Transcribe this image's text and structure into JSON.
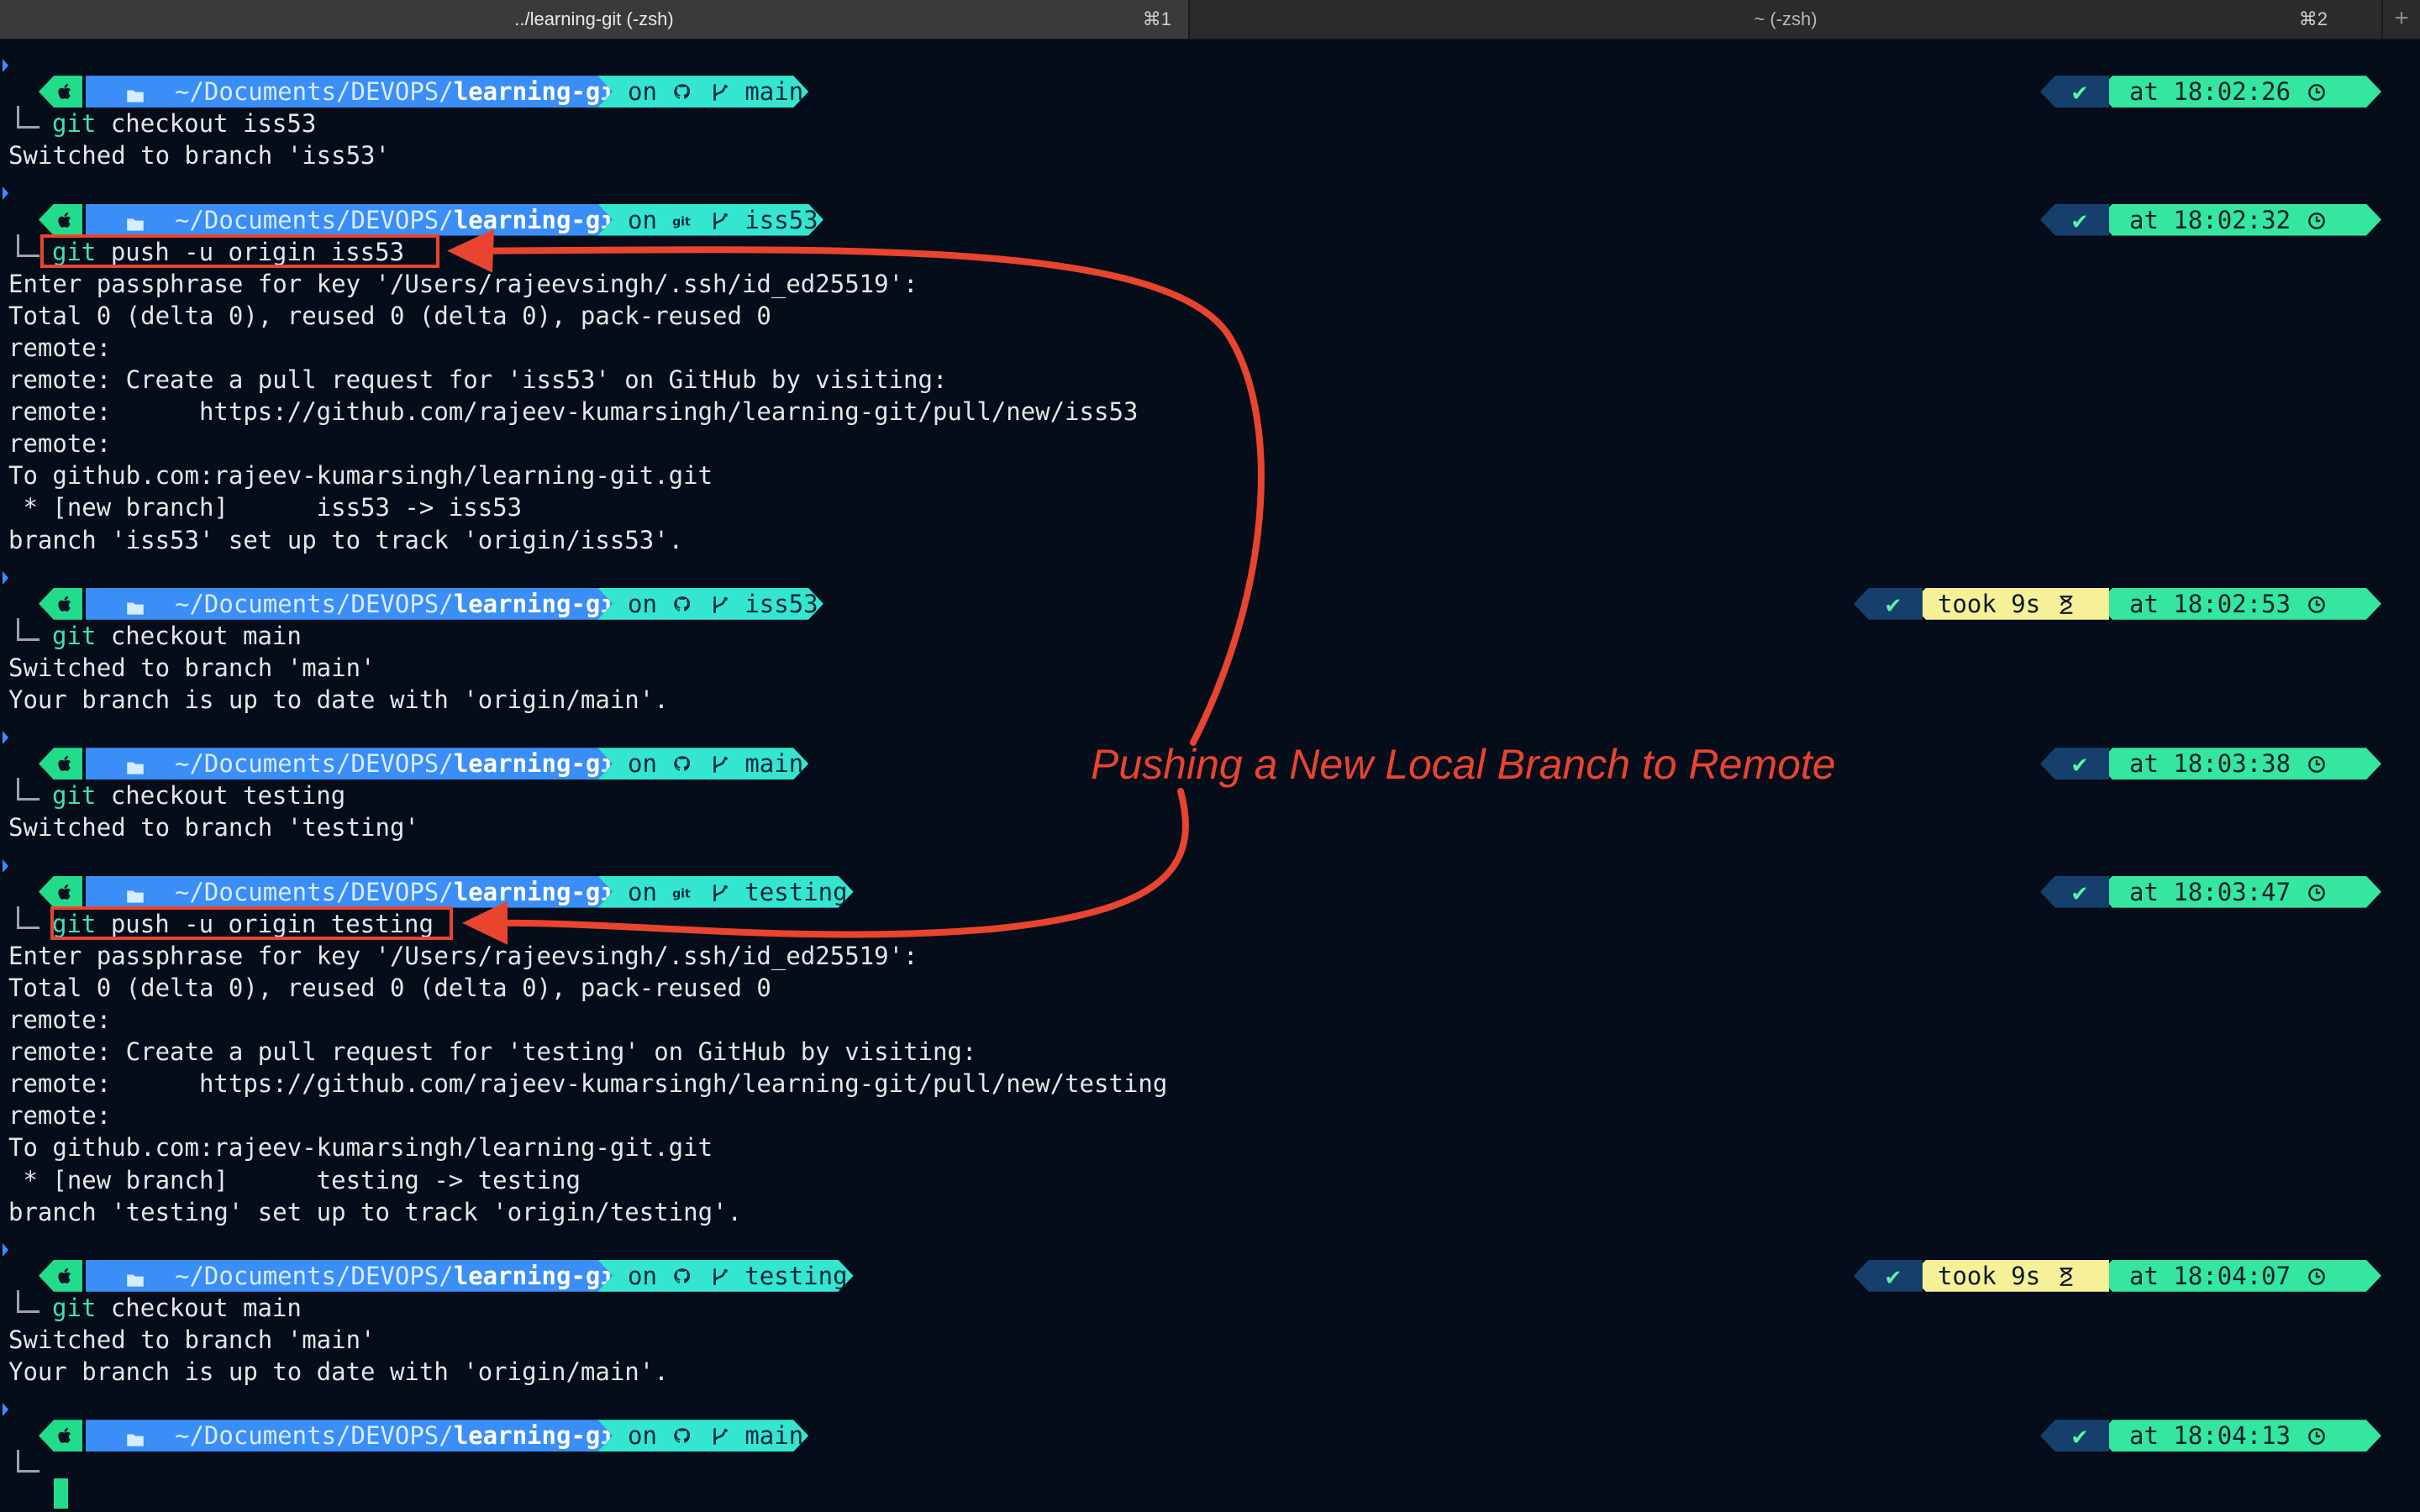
{
  "tabs": [
    {
      "title": "../learning-git (-zsh)",
      "shortcut": "⌘1"
    },
    {
      "title": "~ (-zsh)",
      "shortcut": "⌘2"
    }
  ],
  "new_tab_icon": "+",
  "prompt_common": {
    "path_prefix": "~/Documents/DEVOPS/",
    "path_repo": "learning-git",
    "on": "on",
    "status_ok": "✔",
    "at": "at"
  },
  "prompts": [
    {
      "branch": "main",
      "time": "18:02:26",
      "took": "",
      "git_icon": "github-icon"
    },
    {
      "branch": "iss53",
      "time": "18:02:32",
      "took": "",
      "git_icon": "git-icon"
    },
    {
      "branch": "iss53",
      "time": "18:02:53",
      "took": "took 9s",
      "git_icon": "github-icon"
    },
    {
      "branch": "main",
      "time": "18:03:38",
      "took": "",
      "git_icon": "github-icon"
    },
    {
      "branch": "testing",
      "time": "18:03:47",
      "took": "",
      "git_icon": "git-icon"
    },
    {
      "branch": "testing",
      "time": "18:04:07",
      "took": "took 9s",
      "git_icon": "github-icon"
    },
    {
      "branch": "main",
      "time": "18:04:13",
      "took": "",
      "git_icon": "github-icon"
    }
  ],
  "commands": [
    {
      "git": "git",
      "rest": " checkout iss53"
    },
    {
      "git": "git",
      "rest": " push -u origin iss53"
    },
    {
      "git": "git",
      "rest": " checkout main"
    },
    {
      "git": "git",
      "rest": " checkout testing"
    },
    {
      "git": "git",
      "rest": " push -u origin testing"
    },
    {
      "git": "git",
      "rest": " checkout main"
    }
  ],
  "outputs": [
    [
      "Switched to branch 'iss53'"
    ],
    [
      "Enter passphrase for key '/Users/rajeevsingh/.ssh/id_ed25519':",
      "Total 0 (delta 0), reused 0 (delta 0), pack-reused 0",
      "remote:",
      "remote: Create a pull request for 'iss53' on GitHub by visiting:",
      "remote:      https://github.com/rajeev-kumarsingh/learning-git/pull/new/iss53",
      "remote:",
      "To github.com:rajeev-kumarsingh/learning-git.git",
      " * [new branch]      iss53 -> iss53",
      "branch 'iss53' set up to track 'origin/iss53'."
    ],
    [
      "Switched to branch 'main'",
      "Your branch is up to date with 'origin/main'."
    ],
    [
      "Switched to branch 'testing'"
    ],
    [
      "Enter passphrase for key '/Users/rajeevsingh/.ssh/id_ed25519':",
      "Total 0 (delta 0), reused 0 (delta 0), pack-reused 0",
      "remote:",
      "remote: Create a pull request for 'testing' on GitHub by visiting:",
      "remote:      https://github.com/rajeev-kumarsingh/learning-git/pull/new/testing",
      "remote:",
      "To github.com:rajeev-kumarsingh/learning-git.git",
      " * [new branch]      testing -> testing",
      "branch 'testing' set up to track 'origin/testing'."
    ],
    [
      "Switched to branch 'main'",
      "Your branch is up to date with 'origin/main'."
    ]
  ],
  "annotation": "Pushing a New Local Branch to Remote",
  "colors": {
    "background": "#050d1a",
    "annotation_red": "#e8442f",
    "apple_segment": "#22dc8c",
    "path_segment": "#3a8ef6",
    "git_segment": "#34e6d0",
    "time_segment": "#34e6a0",
    "took_segment": "#f6f098",
    "ok_segment": "#163f6b"
  }
}
